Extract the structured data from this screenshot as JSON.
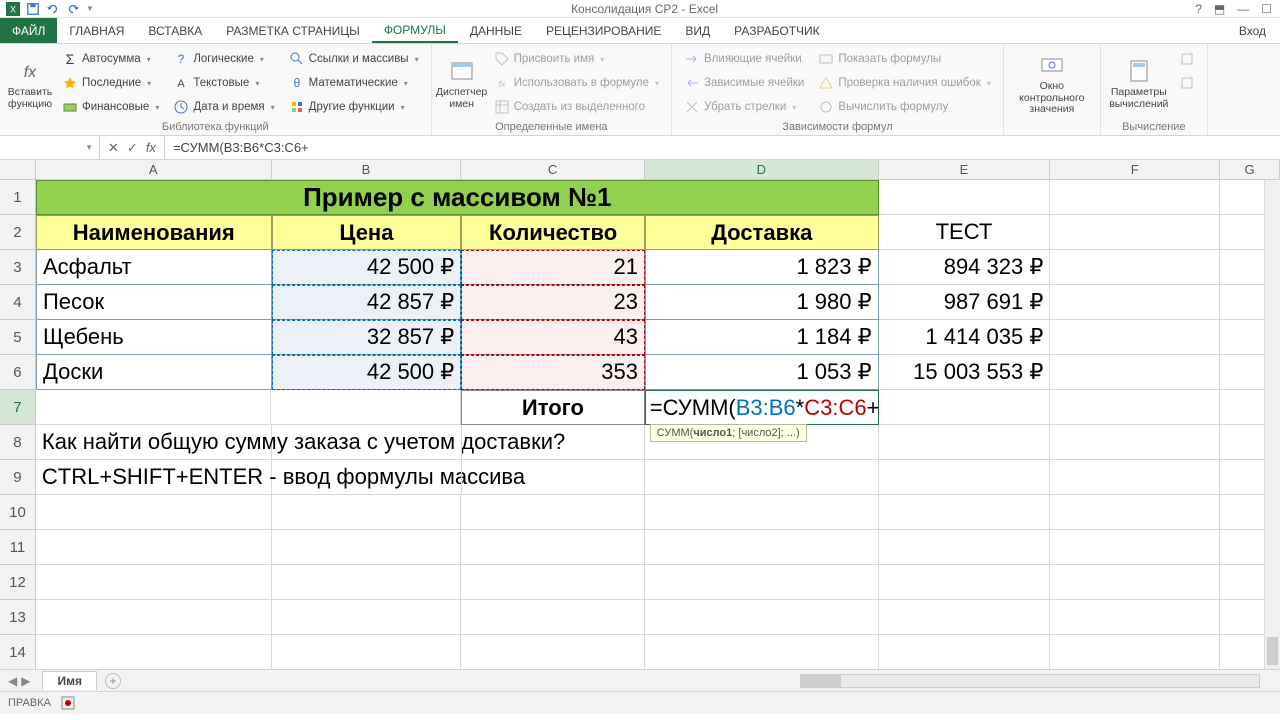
{
  "app": {
    "title": "Консолидация CP2 - Excel"
  },
  "tabs": {
    "file": "ФАЙЛ",
    "home": "ГЛАВНАЯ",
    "insert": "ВСТАВКА",
    "pagelayout": "РАЗМЕТКА СТРАНИЦЫ",
    "formulas": "ФОРМУЛЫ",
    "data": "ДАННЫЕ",
    "review": "РЕЦЕНЗИРОВАНИЕ",
    "view": "ВИД",
    "developer": "РАЗРАБОТЧИК",
    "signin": "Вход"
  },
  "ribbon": {
    "insert_fn": "Вставить\nфункцию",
    "lib": {
      "autosum": "Автосумма",
      "recent": "Последние",
      "financial": "Финансовые",
      "logical": "Логические",
      "text": "Текстовые",
      "datetime": "Дата и время",
      "lookup": "Ссылки и массивы",
      "math": "Математические",
      "more": "Другие функции",
      "group": "Библиотека функций"
    },
    "names": {
      "manager": "Диспетчер\nимен",
      "define": "Присвоить имя",
      "use": "Использовать в формуле",
      "create": "Создать из выделенного",
      "group": "Определенные имена"
    },
    "audit": {
      "precedents": "Влияющие ячейки",
      "dependents": "Зависимые ячейки",
      "remove": "Убрать стрелки",
      "show": "Показать формулы",
      "check": "Проверка наличия ошибок",
      "eval": "Вычислить формулу",
      "group": "Зависимости формул"
    },
    "watch": "Окно контрольного\nзначения",
    "calc": {
      "options": "Параметры\nвычислений",
      "group": "Вычисление"
    }
  },
  "namebox": "",
  "formula": "=СУММ(B3:B6*C3:C6+",
  "cols": [
    "A",
    "B",
    "C",
    "D",
    "E",
    "F",
    "G"
  ],
  "sheet": {
    "title": "Пример с массивом №1",
    "h_name": "Наименования",
    "h_price": "Цена",
    "h_qty": "Количество",
    "h_ship": "Доставка",
    "e2": "ТЕСТ",
    "r3": {
      "a": "Асфальт",
      "b": "42 500 ₽",
      "c": "21",
      "d": "1 823 ₽",
      "e": "894 323 ₽"
    },
    "r4": {
      "a": "Песок",
      "b": "42 857 ₽",
      "c": "23",
      "d": "1 980 ₽",
      "e": "987 691 ₽"
    },
    "r5": {
      "a": "Щебень",
      "b": "32 857 ₽",
      "c": "43",
      "d": "1 184 ₽",
      "e": "1 414 035 ₽"
    },
    "r6": {
      "a": "Доски",
      "b": "42 500 ₽",
      "c": "353",
      "d": "1 053 ₽",
      "e": "15 003 553 ₽"
    },
    "itogo": "Итого",
    "edit_prefix": "=СУММ(",
    "edit_b": "B3:B6",
    "edit_star": "*",
    "edit_c": "C3:C6",
    "edit_suffix": "+",
    "tooltip_fn": "СУММ(",
    "tooltip_arg1": "число1",
    "tooltip_rest": "; [число2]; ...)",
    "r8": "Как найти общую сумму заказа с учетом доставки?",
    "r9": "CTRL+SHIFT+ENTER - ввод формулы массива"
  },
  "rows": [
    "1",
    "2",
    "3",
    "4",
    "5",
    "6",
    "7",
    "8",
    "9",
    "10",
    "11",
    "12",
    "13",
    "14"
  ],
  "sheettab": "Имя",
  "status": "ПРАВКА"
}
